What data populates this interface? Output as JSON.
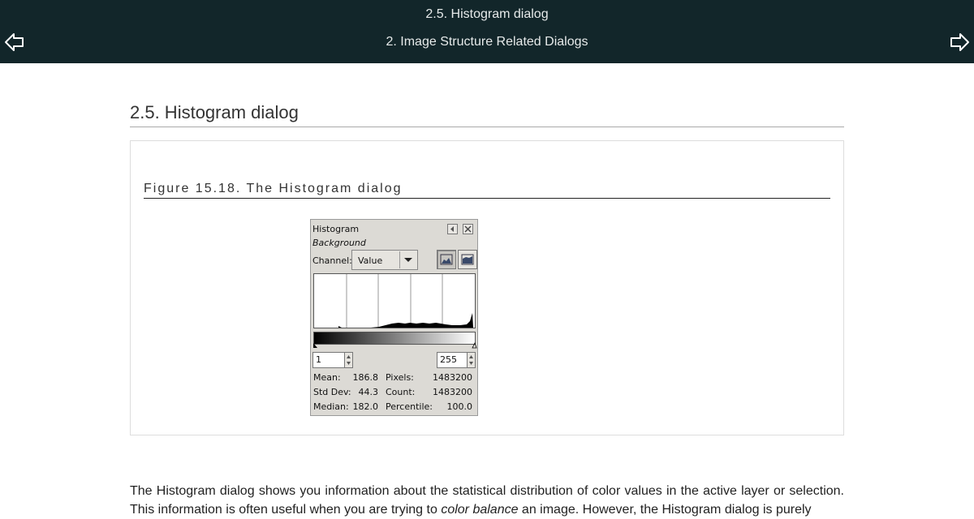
{
  "header": {
    "title": "2.5. Histogram dialog",
    "subtitle": "2. Image Structure Related Dialogs",
    "prev_icon": "left-arrow-icon",
    "next_icon": "right-arrow-icon"
  },
  "section": {
    "title": "2.5. Histogram dialog"
  },
  "figure": {
    "title": "Figure 15.18. The Histogram dialog",
    "dialog": {
      "title": "Histogram",
      "layer": "Background",
      "channel_label": "Channel:",
      "channel_value": "Value",
      "range_start": "1",
      "range_end": "255",
      "stats": {
        "mean_label": "Mean:",
        "mean": "186.8",
        "stddev_label": "Std Dev:",
        "stddev": "44.3",
        "median_label": "Median:",
        "median": "182.0",
        "pixels_label": "Pixels:",
        "pixels": "1483200",
        "count_label": "Count:",
        "count": "1483200",
        "percentile_label": "Percentile:",
        "percentile": "100.0"
      }
    }
  },
  "paragraph": {
    "line1": "The Histogram dialog shows you information about the statistical distribution of color values in the active layer or selection.",
    "line2_start": "This information is often useful when you are trying to ",
    "line2_em": "color balance",
    "line2_end": " an image. However, the Histogram dialog is purely"
  },
  "colors": {
    "header_bg": "#12262a",
    "header_text": "#e6eaea",
    "dialog_bg": "#dcdad5"
  }
}
